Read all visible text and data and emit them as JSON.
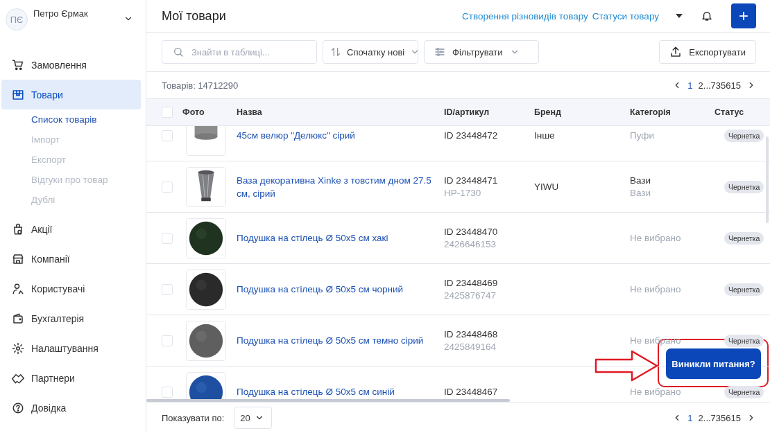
{
  "sidebar": {
    "user": {
      "initials": "ПЄ",
      "name": "Петро Єрмак"
    },
    "items": [
      {
        "kind": "cart",
        "label": "Замовлення",
        "selected": false
      },
      {
        "kind": "box",
        "label": "Товари",
        "selected": true,
        "children": [
          {
            "label": "Список товарів",
            "selected": true
          },
          {
            "label": "Імпорт",
            "selected": false
          },
          {
            "label": "Експорт",
            "selected": false
          },
          {
            "label": "Відгуки про товар",
            "selected": false
          },
          {
            "label": "Дублі",
            "selected": false
          }
        ]
      },
      {
        "kind": "promo",
        "label": "Акції",
        "selected": false
      },
      {
        "kind": "building",
        "label": "Компанії",
        "selected": false
      },
      {
        "kind": "users",
        "label": "Користувачі",
        "selected": false
      },
      {
        "kind": "wallet",
        "label": "Бухгалтерія",
        "selected": false
      },
      {
        "kind": "gear",
        "label": "Налаштування",
        "selected": false
      },
      {
        "kind": "handshake",
        "label": "Партнери",
        "selected": false
      },
      {
        "kind": "help",
        "label": "Довідка",
        "selected": false
      }
    ]
  },
  "header": {
    "title": "Мої товари",
    "links": [
      "Створення різновидів товару",
      "Статуси товару"
    ],
    "add_button": "+"
  },
  "toolbar": {
    "search": {
      "placeholder": "Знайти в таблиці..."
    },
    "sort": "Спочатку нові",
    "filter": "Фільтрувати",
    "export": "Експортувати"
  },
  "count": "Товарів: 14712290",
  "pagination": [
    {
      "label": "1",
      "selected": true
    },
    {
      "label": "2...735615",
      "selected": false
    }
  ],
  "table": {
    "select_all": {
      "checked": false
    },
    "columns": [
      "Фото",
      "Назва",
      "ID/артикул",
      "Бренд",
      "Категорія",
      "Статус"
    ],
    "rows": [
      {
        "checked": false,
        "photo": {
          "kind": "picture"
        },
        "name": "45см велюр \"Делюкс\" сірий",
        "id": "ID 23448472",
        "brand": "Інше",
        "category": [
          {
            "text": "Пуфи",
            "muted": true
          }
        ],
        "status": "Чернетка"
      },
      {
        "checked": false,
        "photo": {
          "kind": "picture"
        },
        "name": "Ваза декоративна Xinke з товстим дном 27.5 см, сірий",
        "id": "ID 23448471",
        "sku": "HP-1730",
        "brand": "YIWU",
        "category": [
          {
            "text": "Вази",
            "muted": false
          },
          {
            "text": "Вази",
            "muted": true
          }
        ],
        "status": "Чернетка"
      },
      {
        "checked": false,
        "photo": {
          "kind": "picture"
        },
        "name": "Подушка на стілець Ø 50x5 см хакі",
        "id": "ID 23448470",
        "sku": "2426646153",
        "category": [
          {
            "text": "Не вибрано",
            "muted": true
          }
        ],
        "status": "Чернетка"
      },
      {
        "checked": false,
        "photo": {
          "kind": "picture"
        },
        "name": "Подушка на стілець Ø 50x5 см чорний",
        "id": "ID 23448469",
        "sku": "2425876747",
        "category": [
          {
            "text": "Не вибрано",
            "muted": true
          }
        ],
        "status": "Чернетка"
      },
      {
        "checked": false,
        "photo": {
          "kind": "picture"
        },
        "name": "Подушка на стілець Ø 50x5 см темно сірий",
        "id": "ID 23448468",
        "sku": "2425849164",
        "category": [
          {
            "text": "Не вибрано",
            "muted": true
          }
        ],
        "status": "Чернетка"
      },
      {
        "checked": false,
        "photo": {
          "kind": "picture"
        },
        "name": "Подушка на стілець Ø 50x5 см синій",
        "id": "ID 23448467",
        "category": [
          {
            "text": "Не вибрано",
            "muted": true
          }
        ],
        "status": "Чернетка"
      }
    ]
  },
  "footer": {
    "page_size_label": "Показувати по:",
    "page_size": "20",
    "pagination": [
      {
        "label": "1",
        "selected": true
      },
      {
        "label": "2...735615",
        "selected": false
      }
    ]
  },
  "help_button": "Виникли питання?"
}
